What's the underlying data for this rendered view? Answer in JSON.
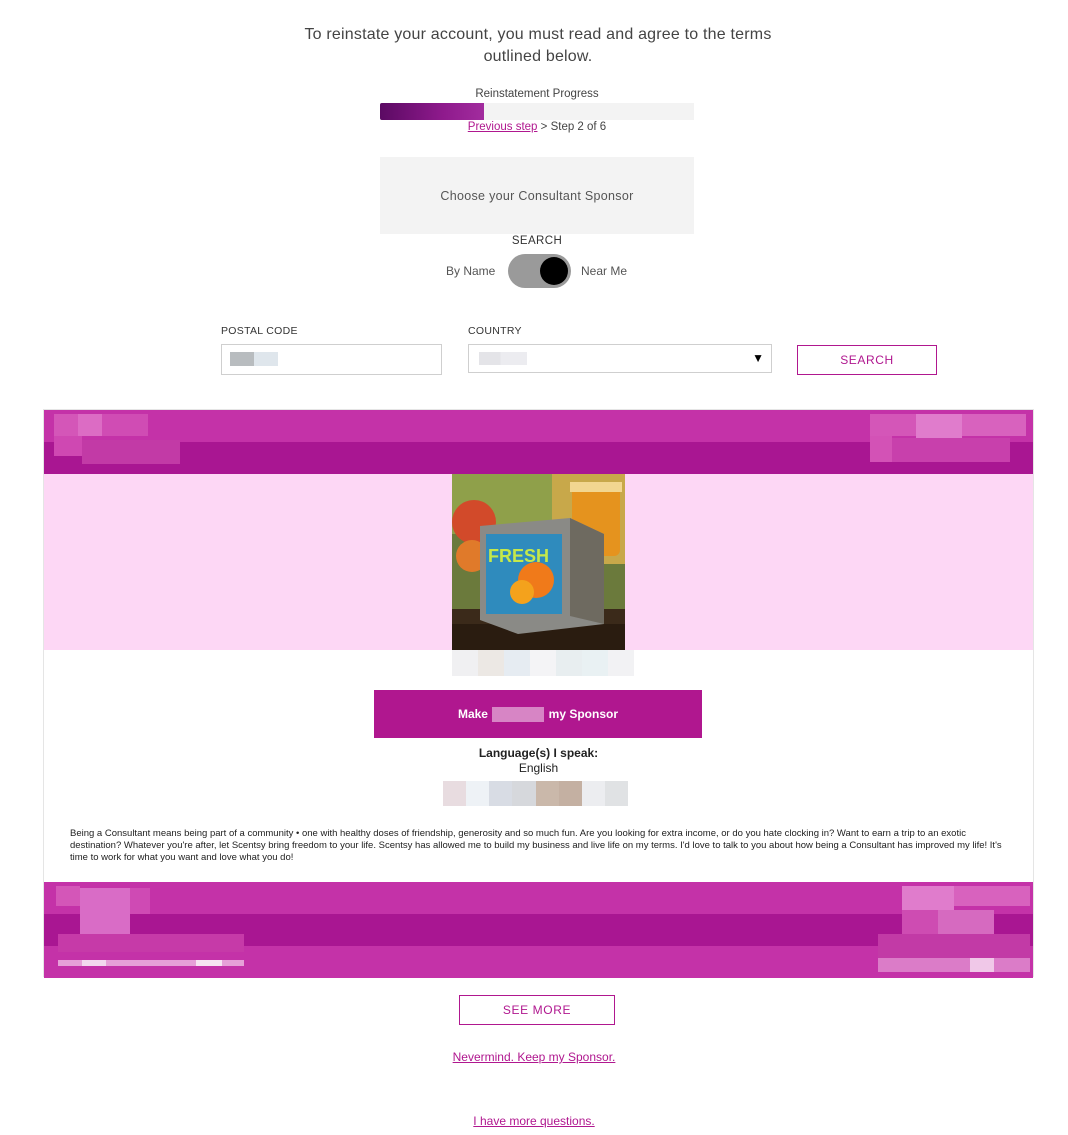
{
  "intro_text": "To reinstate your account, you must read and agree to the terms outlined below.",
  "progress": {
    "label": "Reinstatement Progress",
    "value": 0.33,
    "previous_link": "Previous step",
    "step_text": " > Step 2 of 6"
  },
  "choose_heading": "Choose your Consultant Sponsor",
  "search": {
    "heading": "SEARCH",
    "by_name": "By Name",
    "near_me": "Near Me",
    "near_me_active": true
  },
  "form": {
    "postal_label": "POSTAL CODE",
    "country_label": "COUNTRY",
    "search_button": "SEARCH"
  },
  "consultant": {
    "make_prefix": "Make",
    "make_suffix": "my Sponsor",
    "languages_label": "Language(s) I speak:",
    "languages": "English",
    "bio": "Being a Consultant means being part of a community • one with healthy doses of friendship, generosity and so much fun. Are you looking for extra income, or do you hate clocking in? Want to earn a trip to an exotic destination? Whatever you're after, let Scentsy bring freedom to your life. Scentsy has allowed me to build my business and live life on my terms. I'd love to talk to you about how being a Consultant has improved my life! It's time to work for what you want and love what you do!",
    "product_label": "FRESH"
  },
  "actions": {
    "see_more": "SEE MORE",
    "keep_sponsor": "Nevermind. Keep my Sponsor.",
    "more_questions": "I have more questions."
  },
  "colors": {
    "brand": "#b0178f",
    "progress": "#7a1278",
    "hero_bg": "#fdd7f5"
  }
}
